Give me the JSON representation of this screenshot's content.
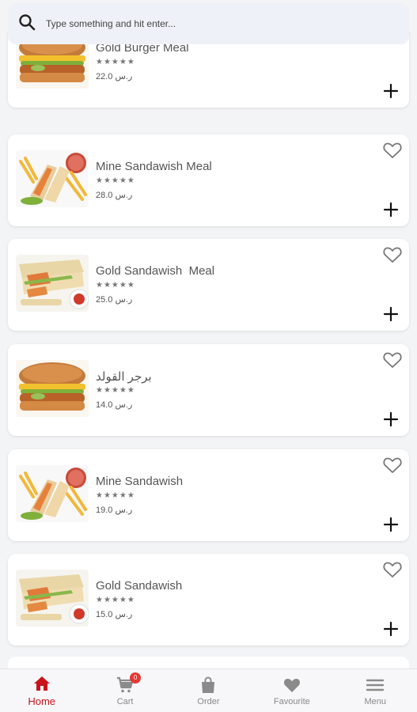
{
  "search": {
    "placeholder": "Type something and hit enter..."
  },
  "items": [
    {
      "title": "Gold Burger Meal",
      "stars": "★★★★★",
      "price": "22.0 ر.س",
      "image": "burger"
    },
    {
      "title": "Mine Sandawish Meal",
      "stars": "★★★★★",
      "price": "28.0 ر.س",
      "image": "fries-wrap"
    },
    {
      "title": "Gold Sandawish  Meal",
      "stars": "★★★★★",
      "price": "25.0 ر.س",
      "image": "tortilla-wrap"
    },
    {
      "title": "برجر القولد",
      "stars": "★★★★★",
      "price": "14.0 ر.س",
      "image": "burger"
    },
    {
      "title": "Mine Sandawish",
      "stars": "★★★★★",
      "price": "19.0 ر.س",
      "image": "fries-wrap"
    },
    {
      "title": "Gold Sandawish",
      "stars": "★★★★★",
      "price": "15.0 ر.س",
      "image": "tortilla-wrap"
    }
  ],
  "icons": {
    "search": "search-icon",
    "favourite": "heart-outline-icon",
    "add": "plus-icon"
  },
  "nav": {
    "home": {
      "label": "Home",
      "icon": "home-icon"
    },
    "cart": {
      "label": "Cart",
      "icon": "cart-icon",
      "badge": "0"
    },
    "order": {
      "label": "Order",
      "icon": "shopping-bag-icon"
    },
    "favourite": {
      "label": "Favourite",
      "icon": "heart-icon"
    },
    "menu": {
      "label": "Menu",
      "icon": "hamburger-menu-icon"
    }
  },
  "colors": {
    "accent": "#c8141b",
    "badge": "#e53935",
    "inactive": "#888888"
  }
}
